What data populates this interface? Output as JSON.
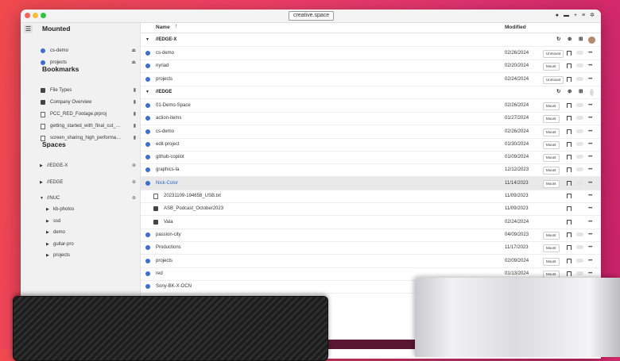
{
  "window": {
    "title": "creative.space"
  },
  "sidebar": {
    "mounted_title": "Mounted",
    "mounted": [
      {
        "label": "cs-demo",
        "icon": "eject-icon"
      },
      {
        "label": "projects",
        "icon": "eject-icon"
      }
    ],
    "bookmarks_title": "Bookmarks",
    "bookmarks": [
      {
        "label": "File Types",
        "type": "folder"
      },
      {
        "label": "Company Overview",
        "type": "folder"
      },
      {
        "label": "PCC_RED_Footage.prproj",
        "type": "file"
      },
      {
        "label": "getting_started_with_final_cut_pr...",
        "type": "file"
      },
      {
        "label": "screen_sharing_high_performanc...",
        "type": "file"
      }
    ],
    "spaces_title": "Spaces",
    "spaces": [
      {
        "label": "//EDGE-X"
      },
      {
        "label": "//EDGE"
      },
      {
        "label": "//NUC"
      }
    ],
    "nuc_children": [
      "kb-photos",
      "ssd",
      "demo",
      "guitar-pro",
      "projects"
    ]
  },
  "columns": {
    "name": "Name",
    "modified": "Modified",
    "sort_icon": "arrow-up-icon"
  },
  "groups": [
    {
      "label": "//EDGE-X",
      "rows": [
        {
          "name": "cs-demo",
          "date": "02/26/2024",
          "action": "Unmount"
        },
        {
          "name": "nyriad",
          "date": "02/20/2024",
          "action": "Mount"
        },
        {
          "name": "projects",
          "date": "02/24/2024",
          "action": "Unmount"
        }
      ]
    },
    {
      "label": "//EDGE",
      "rows": [
        {
          "name": "01-Demo-Space",
          "date": "02/26/2024",
          "action": "Mount"
        },
        {
          "name": "action-items",
          "date": "01/27/2024",
          "action": "Mount"
        },
        {
          "name": "cs-demo",
          "date": "02/26/2024",
          "action": "Mount"
        },
        {
          "name": "edit-project",
          "date": "01/30/2024",
          "action": "Mount"
        },
        {
          "name": "github-copilot",
          "date": "01/09/2024",
          "action": "Mount"
        },
        {
          "name": "graphics-la",
          "date": "12/12/2023",
          "action": "Mount"
        },
        {
          "name": "Nick-Color",
          "date": "11/14/2023",
          "action": "Mount",
          "selected": true
        },
        {
          "name": "20231109-194658_USB.txt",
          "date": "11/09/2023",
          "kind": "file",
          "indent": 1
        },
        {
          "name": "ASB_Podcast_October2023",
          "date": "11/09/2023",
          "kind": "folder",
          "indent": 1
        },
        {
          "name": "Vala",
          "date": "02/24/2024",
          "kind": "folder",
          "indent": 1
        },
        {
          "name": "passion-city",
          "date": "04/09/2023",
          "action": "Mount"
        },
        {
          "name": "Productions",
          "date": "11/17/2023",
          "action": "Mount"
        },
        {
          "name": "projects",
          "date": "02/09/2024",
          "action": "Mount"
        },
        {
          "name": "red",
          "date": "01/13/2024",
          "action": "Mount"
        },
        {
          "name": "Sony-BK-X-OCN",
          "date": "",
          "action": ""
        }
      ]
    }
  ],
  "colors": {
    "accent": "#3c6fd6",
    "selected_text": "#2c66c8",
    "bg_gradient_start": "#f04a4e",
    "bg_gradient_end": "#c9216a"
  }
}
